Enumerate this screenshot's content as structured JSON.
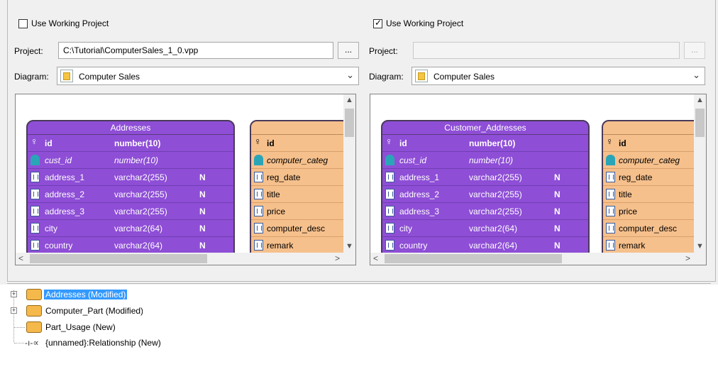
{
  "left": {
    "use_working_project": {
      "label": "Use Working Project",
      "checked": false
    },
    "project_label": "Project:",
    "project_value": "C:\\Tutorial\\ComputerSales_1_0.vpp",
    "browse_label": "...",
    "diagram_label": "Diagram:",
    "diagram_value": "Computer Sales",
    "entity_main": {
      "title": "Addresses",
      "rows": [
        {
          "name": "id",
          "type": "number(10)",
          "flag": "",
          "kind": "pk"
        },
        {
          "name": "cust_id",
          "type": "number(10)",
          "flag": "",
          "kind": "fk"
        },
        {
          "name": "address_1",
          "type": "varchar2(255)",
          "flag": "N",
          "kind": "col"
        },
        {
          "name": "address_2",
          "type": "varchar2(255)",
          "flag": "N",
          "kind": "col"
        },
        {
          "name": "address_3",
          "type": "varchar2(255)",
          "flag": "N",
          "kind": "col"
        },
        {
          "name": "city",
          "type": "varchar2(64)",
          "flag": "N",
          "kind": "col"
        },
        {
          "name": "country",
          "type": "varchar2(64)",
          "flag": "N",
          "kind": "col"
        }
      ]
    },
    "entity_side": {
      "rows": [
        {
          "name": "id",
          "kind": "pk"
        },
        {
          "name": "computer_categ",
          "kind": "fk"
        },
        {
          "name": "reg_date",
          "kind": "col"
        },
        {
          "name": "title",
          "kind": "col"
        },
        {
          "name": "price",
          "kind": "col"
        },
        {
          "name": "computer_desc",
          "kind": "col"
        },
        {
          "name": "remark",
          "kind": "col"
        }
      ]
    }
  },
  "right": {
    "use_working_project": {
      "label": "Use Working Project",
      "checked": true
    },
    "project_label": "Project:",
    "project_value": "",
    "browse_label": "...",
    "diagram_label": "Diagram:",
    "diagram_value": "Computer Sales",
    "entity_main": {
      "title": "Customer_Addresses",
      "rows": [
        {
          "name": "id",
          "type": "number(10)",
          "flag": "",
          "kind": "pk"
        },
        {
          "name": "cust_id",
          "type": "number(10)",
          "flag": "",
          "kind": "fk"
        },
        {
          "name": "address_1",
          "type": "varchar2(255)",
          "flag": "N",
          "kind": "col"
        },
        {
          "name": "address_2",
          "type": "varchar2(255)",
          "flag": "N",
          "kind": "col"
        },
        {
          "name": "address_3",
          "type": "varchar2(255)",
          "flag": "N",
          "kind": "col"
        },
        {
          "name": "city",
          "type": "varchar2(64)",
          "flag": "N",
          "kind": "col"
        },
        {
          "name": "country",
          "type": "varchar2(64)",
          "flag": "N",
          "kind": "col"
        }
      ]
    },
    "entity_side": {
      "rows": [
        {
          "name": "id",
          "kind": "pk"
        },
        {
          "name": "computer_categ",
          "kind": "fk"
        },
        {
          "name": "reg_date",
          "kind": "col"
        },
        {
          "name": "title",
          "kind": "col"
        },
        {
          "name": "price",
          "kind": "col"
        },
        {
          "name": "computer_desc",
          "kind": "col"
        },
        {
          "name": "remark",
          "kind": "col"
        }
      ]
    }
  },
  "tree": [
    {
      "label": "Addresses (Modified)",
      "icon": "table-icon",
      "expandable": true,
      "selected": true
    },
    {
      "label": "Computer_Part (Modified)",
      "icon": "table-icon",
      "expandable": true,
      "selected": false
    },
    {
      "label": "Part_Usage (New)",
      "icon": "table-icon",
      "expandable": false,
      "selected": false
    },
    {
      "label": "{unnamed}:Relationship (New)",
      "icon": "relationship-icon",
      "expandable": false,
      "selected": false
    }
  ],
  "colors": {
    "entity_purple": "#8e4ed6",
    "entity_orange": "#f6c08c",
    "selection": "#3399ff"
  }
}
